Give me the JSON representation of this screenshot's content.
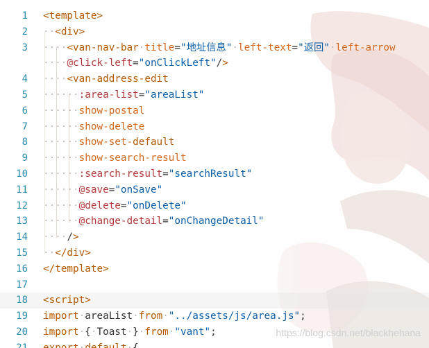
{
  "editor": {
    "lines": [
      {
        "num": "1",
        "text": "<template>"
      },
      {
        "num": "2",
        "text": "··<div>"
      },
      {
        "num": "3",
        "text": "····<van-nav-bar·title=\"地址信息\"·left-text=\"返回\"·left-arrow"
      },
      {
        "num": "",
        "text": "····@click-left=\"onClickLeft\"/>"
      },
      {
        "num": "4",
        "text": "····<van-address-edit"
      },
      {
        "num": "5",
        "text": "······:area-list=\"areaList\""
      },
      {
        "num": "6",
        "text": "······show-postal"
      },
      {
        "num": "7",
        "text": "······show-delete"
      },
      {
        "num": "8",
        "text": "······show-set-default"
      },
      {
        "num": "9",
        "text": "······show-search-result"
      },
      {
        "num": "10",
        "text": "······:search-result=\"searchResult\""
      },
      {
        "num": "11",
        "text": "······@save=\"onSave\""
      },
      {
        "num": "12",
        "text": "······@delete=\"onDelete\""
      },
      {
        "num": "13",
        "text": "······@change-detail=\"onChangeDetail\""
      },
      {
        "num": "14",
        "text": "····/>"
      },
      {
        "num": "15",
        "text": "··</div>"
      },
      {
        "num": "16",
        "text": "</template>"
      },
      {
        "num": "17",
        "text": ""
      },
      {
        "num": "18",
        "text": "<script>"
      },
      {
        "num": "19",
        "text": "import·areaList·from·\"../assets/js/area.js\";"
      },
      {
        "num": "20",
        "text": "import·{·Toast·}·from·\"vant\";"
      },
      {
        "num": "21",
        "text": "export·default·{"
      }
    ]
  },
  "watermark": {
    "text": "https://blog.csdn.net/blackhehana"
  },
  "colors": {
    "gutter_numbers": "#2a8fb0",
    "tag": "#b35a00",
    "string": "#0b5ea8"
  }
}
